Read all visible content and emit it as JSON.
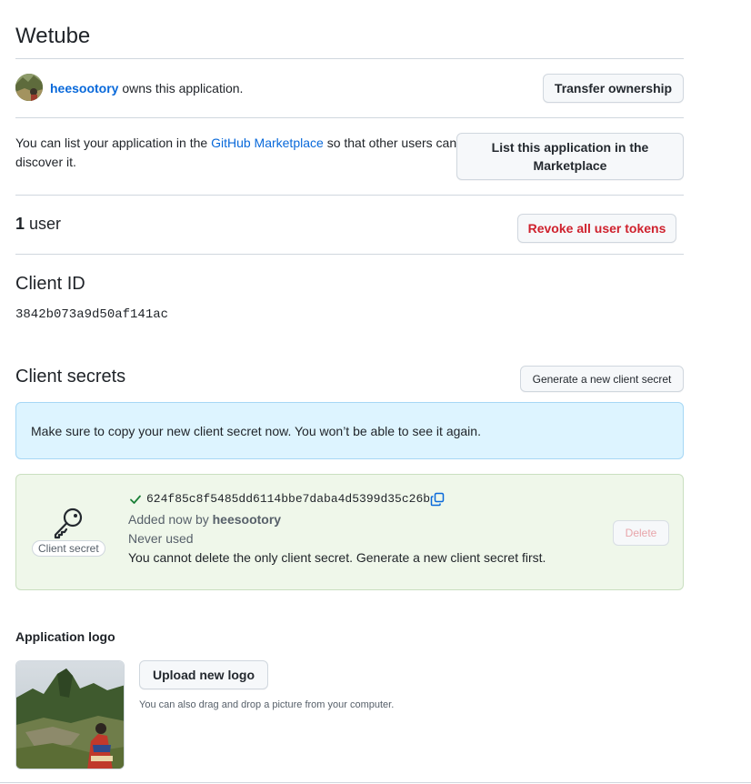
{
  "app": {
    "title": "Wetube"
  },
  "owner": {
    "username": "heesootory",
    "suffix": "owns this application.",
    "transfer_button": "Transfer ownership"
  },
  "marketplace": {
    "text_before": "You can list your application in the",
    "link": "GitHub Marketplace",
    "text_after": "so that other users can discover it.",
    "button": "List this application in the Marketplace"
  },
  "users": {
    "count": "1",
    "label": "user",
    "revoke_button": "Revoke all user tokens"
  },
  "client_id": {
    "heading": "Client ID",
    "value": "3842b073a9d50af141ac"
  },
  "client_secrets": {
    "heading": "Client secrets",
    "generate_button": "Generate a new client secret",
    "flash": "Make sure to copy your new client secret now. You won’t be able to see it again.",
    "secret": {
      "badge": "Client secret",
      "value": "624f85c8f5485dd6114bbe7daba4d5399d35c26b",
      "added_prefix": "Added now by",
      "added_by": "heesootory",
      "usage": "Never used",
      "note": "You cannot delete the only client secret. Generate a new client secret first.",
      "delete_button": "Delete"
    }
  },
  "logo": {
    "heading": "Application logo",
    "upload_button": "Upload new logo",
    "hint": "You can also drag and drop a picture from your computer."
  },
  "colors": {
    "link": "#0969da",
    "danger": "#cf222e",
    "success": "#1a7f37",
    "flash_bg": "#ddf4ff",
    "secret_bg": "#eff7ea",
    "border": "#d0d7de"
  },
  "icons": [
    "avatar",
    "key-icon",
    "check-icon",
    "copy-icon"
  ]
}
